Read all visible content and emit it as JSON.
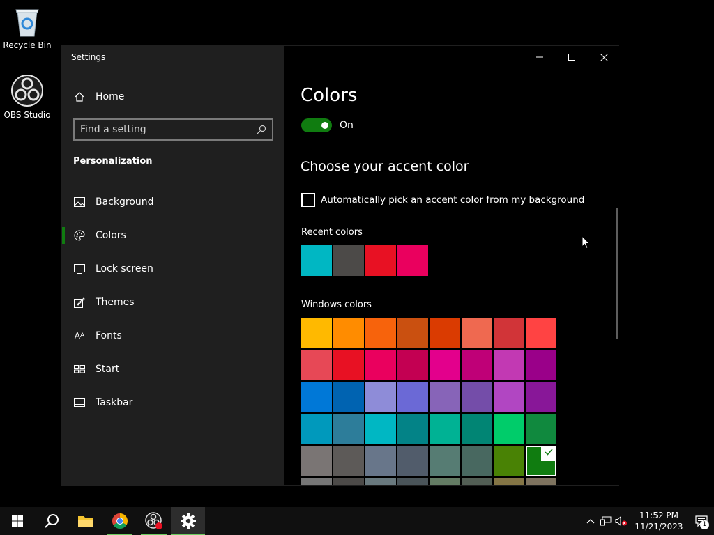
{
  "desktop": {
    "icons": [
      {
        "label": "Recycle Bin",
        "icon": "recycle-bin-icon"
      },
      {
        "label": "OBS Studio",
        "icon": "obs-studio-icon"
      }
    ]
  },
  "window": {
    "title": "Settings",
    "controls": [
      "minimize-icon",
      "maximize-icon",
      "close-icon"
    ]
  },
  "sidebar": {
    "home_label": "Home",
    "search_placeholder": "Find a setting",
    "section_title": "Personalization",
    "items": [
      {
        "label": "Background",
        "icon": "picture-icon"
      },
      {
        "label": "Colors",
        "icon": "palette-icon",
        "active": true
      },
      {
        "label": "Lock screen",
        "icon": "lock-screen-icon"
      },
      {
        "label": "Themes",
        "icon": "brush-icon"
      },
      {
        "label": "Fonts",
        "icon": "fonts-icon"
      },
      {
        "label": "Start",
        "icon": "start-icon"
      },
      {
        "label": "Taskbar",
        "icon": "taskbar-icon"
      }
    ]
  },
  "content": {
    "page_title": "Colors",
    "toggle_label": "On",
    "accent_heading": "Choose your accent color",
    "auto_pick_label": "Automatically pick an accent color from my background",
    "recent_label": "Recent colors",
    "windows_label": "Windows colors",
    "recent_colors": [
      "#00b7c3",
      "#4c4a48",
      "#e81123",
      "#ea005e"
    ],
    "windows_colors": [
      "#ffb900",
      "#ff8c00",
      "#f7630c",
      "#ca5010",
      "#da3b01",
      "#ef6950",
      "#d13438",
      "#ff4343",
      "#e74856",
      "#e81123",
      "#ea005e",
      "#c30052",
      "#e3008c",
      "#bf0077",
      "#c239b3",
      "#9a0089",
      "#0078d7",
      "#0063b1",
      "#8e8cd8",
      "#6b69d6",
      "#8764b8",
      "#744da9",
      "#b146c2",
      "#881798",
      "#0099bc",
      "#2d7d9a",
      "#00b7c3",
      "#038387",
      "#00b294",
      "#018574",
      "#00cc6a",
      "#10893e",
      "#7a7574",
      "#5d5a58",
      "#68768a",
      "#515c6b",
      "#567c73",
      "#486860",
      "#498205",
      "#107c10",
      "#767676",
      "#4c4a48",
      "#69797e",
      "#4a5459",
      "#647c64",
      "#525e54",
      "#847545",
      "#7e735f"
    ],
    "selected_color": "#107c10",
    "accent": "#107c10"
  },
  "taskbar": {
    "apps": [
      "start-icon",
      "search-icon",
      "file-explorer-icon",
      "chrome-icon",
      "obs-studio-icon",
      "settings-gear-icon"
    ],
    "tray_icons": [
      "chevron-up-icon",
      "network-icon",
      "volume-muted-icon"
    ],
    "time": "11:52 PM",
    "date": "11/21/2023",
    "notification_count": "1"
  }
}
